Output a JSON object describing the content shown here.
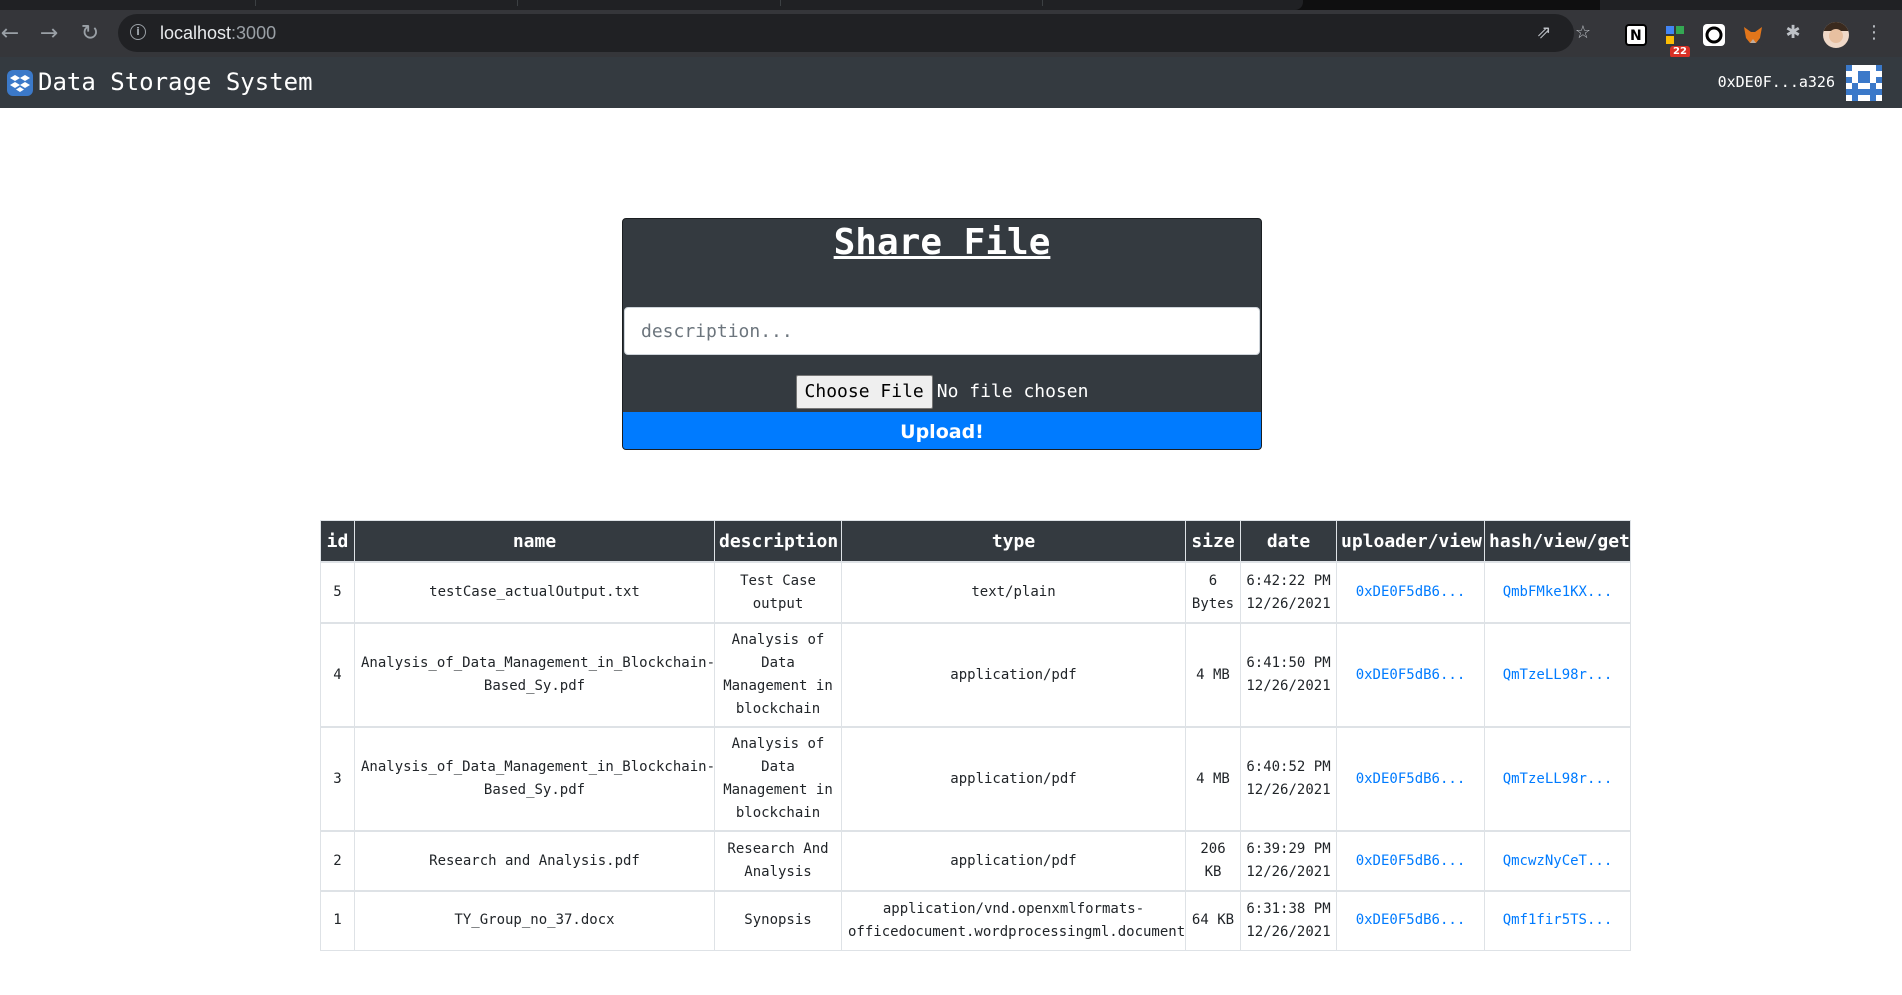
{
  "browser": {
    "url_host": "localhost",
    "url_port": ":3000",
    "extension_badge": "22"
  },
  "app": {
    "title": "Data Storage System",
    "account": "0xDE0F...a326"
  },
  "share_form": {
    "title": "Share File",
    "description_placeholder": "description...",
    "choose_file_label": "Choose File",
    "no_file_text": "No file chosen",
    "upload_label": "Upload!"
  },
  "table": {
    "headers": [
      "id",
      "name",
      "description",
      "type",
      "size",
      "date",
      "uploader/view",
      "hash/view/get"
    ],
    "rows": [
      {
        "id": "5",
        "name": "testCase_actualOutput.txt",
        "description": "Test Case output",
        "type": "text/plain",
        "size": "6 Bytes",
        "date": "6:42:22 PM 12/26/2021",
        "uploader": "0xDE0F5dB6...",
        "hash": "QmbFMke1KX..."
      },
      {
        "id": "4",
        "name": "Analysis_of_Data_Management_in_Blockchain-Based_Sy.pdf",
        "description": "Analysis of Data Management in blockchain",
        "type": "application/pdf",
        "size": "4 MB",
        "date": "6:41:50 PM 12/26/2021",
        "uploader": "0xDE0F5dB6...",
        "hash": "QmTzeLL98r..."
      },
      {
        "id": "3",
        "name": "Analysis_of_Data_Management_in_Blockchain-Based_Sy.pdf",
        "description": "Analysis of Data Management in blockchain",
        "type": "application/pdf",
        "size": "4 MB",
        "date": "6:40:52 PM 12/26/2021",
        "uploader": "0xDE0F5dB6...",
        "hash": "QmTzeLL98r..."
      },
      {
        "id": "2",
        "name": "Research and Analysis.pdf",
        "description": "Research And Analysis",
        "type": "application/pdf",
        "size": "206 KB",
        "date": "6:39:29 PM 12/26/2021",
        "uploader": "0xDE0F5dB6...",
        "hash": "QmcwzNyCeT..."
      },
      {
        "id": "1",
        "name": "TY_Group_no_37.docx",
        "description": "Synopsis",
        "type": "application/vnd.openxmlformats-officedocument.wordprocessingml.document",
        "size": "64 KB",
        "date": "6:31:38 PM 12/26/2021",
        "uploader": "0xDE0F5dB6...",
        "hash": "Qmf1fir5TS..."
      }
    ]
  },
  "colors": {
    "navbar": "#343a40",
    "primary": "#007bff",
    "browser_toolbar": "#35363a"
  }
}
